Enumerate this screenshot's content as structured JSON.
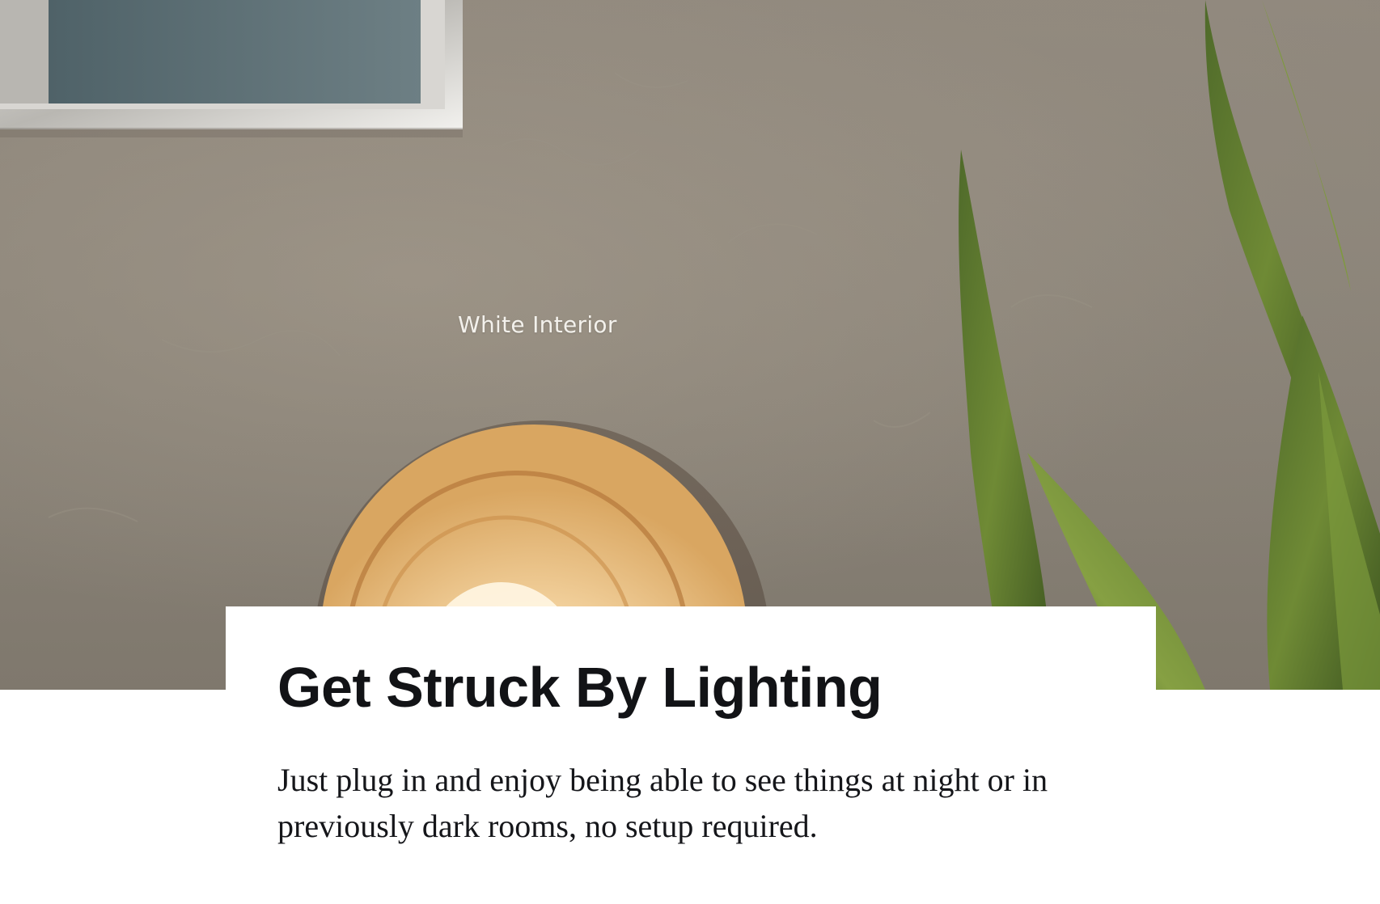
{
  "hero": {
    "image_label": "White Interior",
    "wall_color": "#8a8378"
  },
  "card": {
    "title": "Get Struck By Lighting",
    "body": "Just plug in and enjoy being able to see things at night or in previously dark rooms, no setup required."
  }
}
